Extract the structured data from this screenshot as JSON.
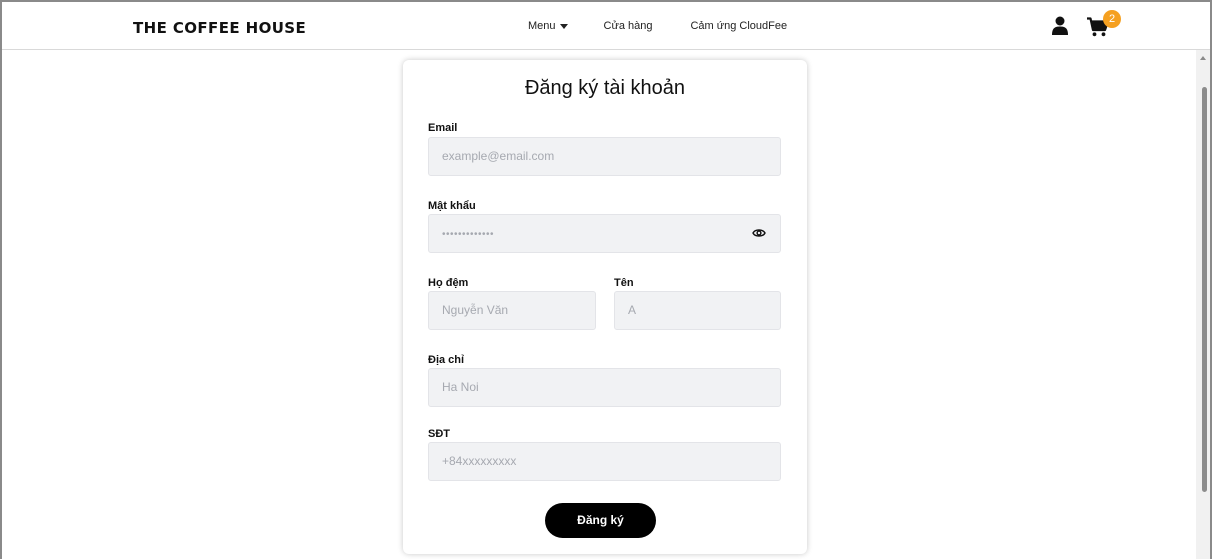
{
  "navbar": {
    "logo": "THE COFFEE HOUSE",
    "links": {
      "menu": "Menu",
      "stores": "Cửa hàng",
      "inspiration": "Cảm ứng CloudFee"
    },
    "cart_count": "2"
  },
  "form": {
    "title": "Đăng ký tài khoản",
    "email": {
      "label": "Email",
      "placeholder": "example@email.com"
    },
    "password": {
      "label": "Mật khẩu",
      "value": "•••••••••••••"
    },
    "last_middle_name": {
      "label": "Họ đệm",
      "placeholder": "Nguyễn Văn"
    },
    "first_name": {
      "label": "Tên",
      "placeholder": "A"
    },
    "address": {
      "label": "Địa chỉ",
      "placeholder": "Ha Noi"
    },
    "phone": {
      "label": "SĐT",
      "placeholder": "+84xxxxxxxxx"
    },
    "submit_label": "Đăng ký"
  },
  "colors": {
    "accent": "#000000",
    "badge": "#f5a020",
    "input_bg": "#f1f2f4"
  },
  "icons": {
    "user": "user-icon",
    "cart": "cart-icon",
    "eye": "eye-icon",
    "caret": "caret-down-icon"
  }
}
